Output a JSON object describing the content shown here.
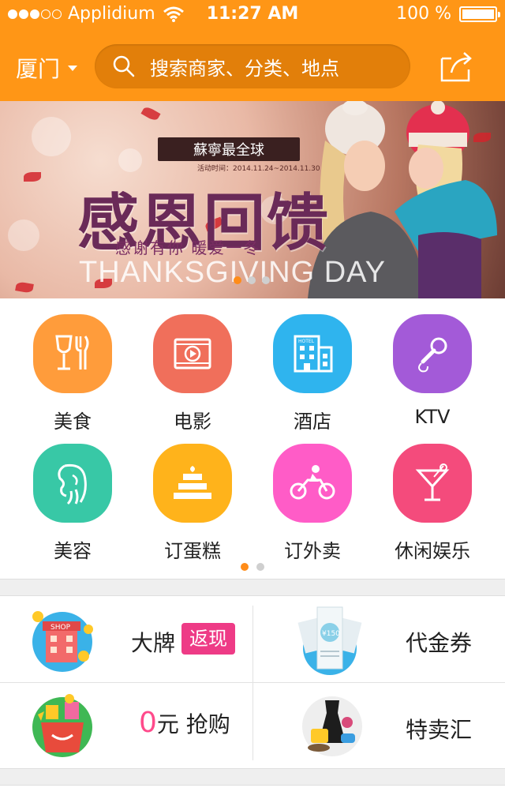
{
  "status_bar": {
    "carrier": "Applidium",
    "time": "11:27 AM",
    "battery": "100 %",
    "signal_bars": 3
  },
  "header": {
    "city": "厦门",
    "search_placeholder": "搜索商家、分类、地点"
  },
  "banner": {
    "brand": "蘇寧最全球",
    "activity_time": "活动时间：2014.11.24~2014.11.30",
    "title": "感恩回馈",
    "subtitle": "感谢有你  暖爱一冬",
    "english_title": "THANKSGIVING DAY",
    "pages": 3,
    "active_page": 1
  },
  "categories": [
    {
      "label": "美食",
      "icon": "fork-knife-glass-icon",
      "color": "#ff9c3b"
    },
    {
      "label": "电影",
      "icon": "film-play-icon",
      "color": "#f06f5b"
    },
    {
      "label": "酒店",
      "icon": "hotel-building-icon",
      "color": "#2fb4ee"
    },
    {
      "label": "KTV",
      "icon": "microphone-icon",
      "color": "#a35ad8"
    },
    {
      "label": "美容",
      "icon": "woman-face-icon",
      "color": "#38c8a6"
    },
    {
      "label": "订蛋糕",
      "icon": "cake-icon",
      "color": "#ffb31b"
    },
    {
      "label": "订外卖",
      "icon": "motorbike-delivery-icon",
      "color": "#ff5cc7"
    },
    {
      "label": "休闲娱乐",
      "icon": "cocktail-icon",
      "color": "#f44b7c"
    }
  ],
  "category_pager": {
    "pages": 2,
    "active_page": 1
  },
  "promos": [
    {
      "label": "大牌",
      "badge": "返现",
      "icon": "shop-building-icon"
    },
    {
      "label": "代金券",
      "icon": "voucher-tickets-icon",
      "voucher_text": "¥150"
    },
    {
      "label_prefix": "0",
      "label": "元 抢购",
      "icon": "gift-bag-icon"
    },
    {
      "label": "特卖汇",
      "icon": "fashion-items-icon"
    }
  ],
  "colors": {
    "header": "#ff9616",
    "accent_pink": "#ee3b86"
  }
}
